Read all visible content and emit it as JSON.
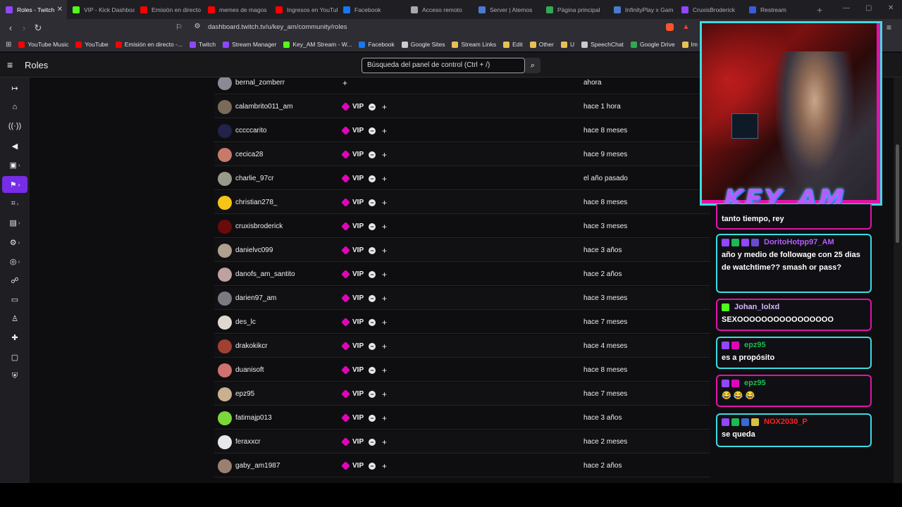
{
  "browser": {
    "tabs": [
      {
        "label": "Roles - Twitch",
        "color": "#9146ff"
      },
      {
        "label": "VIP - Kick Dashboard",
        "color": "#53fc18"
      },
      {
        "label": "Emisión en directo",
        "color": "#ff0000"
      },
      {
        "label": "memes de magos",
        "color": "#ff0000"
      },
      {
        "label": "Ingresos en YouTube",
        "color": "#ff0000"
      },
      {
        "label": "Facebook",
        "color": "#1877f2"
      },
      {
        "label": "Acceso remoto",
        "color": "#aaaaaa"
      },
      {
        "label": "Server | Atemos",
        "color": "#4a7bd0"
      },
      {
        "label": "Página principal",
        "color": "#34a853"
      },
      {
        "label": "InfinityPlay x Gam",
        "color": "#4a7bd0"
      },
      {
        "label": "CruxisBroderick",
        "color": "#9146ff"
      },
      {
        "label": "Restream",
        "color": "#3b5bdb"
      }
    ],
    "url": "dashboard.twitch.tv/u/key_am/community/roles",
    "bookmarks": [
      {
        "label": "YouTube Music",
        "color": "#ff0000"
      },
      {
        "label": "YouTube",
        "color": "#ff0000"
      },
      {
        "label": "Emisión en directo -...",
        "color": "#ff0000"
      },
      {
        "label": "Twitch",
        "color": "#9146ff"
      },
      {
        "label": "Stream Manager",
        "color": "#9146ff"
      },
      {
        "label": "Key_AM Stream - W...",
        "color": "#53fc18"
      },
      {
        "label": "Facebook",
        "color": "#1877f2"
      },
      {
        "label": "Google Sites",
        "color": "#cccccc"
      },
      {
        "label": "Stream Links",
        "color": "#e8c056"
      },
      {
        "label": "Edit",
        "color": "#e8c056"
      },
      {
        "label": "Other",
        "color": "#e8c056"
      },
      {
        "label": "U",
        "color": "#e8c056"
      },
      {
        "label": "SpeechChat",
        "color": "#cccccc"
      },
      {
        "label": "Google Drive",
        "color": "#34a853"
      },
      {
        "label": "Im",
        "color": "#e8c056"
      }
    ]
  },
  "header": {
    "title": "Roles",
    "search_placeholder": "Búsqueda del panel de control (Ctrl + /)"
  },
  "roles_table": {
    "rows": [
      {
        "user": "bernal_zomberr",
        "vip": false,
        "date": "ahora",
        "avatar": "#8a8a96"
      },
      {
        "user": "calambrito011_am",
        "vip": true,
        "date": "hace 1 hora",
        "avatar": "#7a6a5a"
      },
      {
        "user": "cccccarito",
        "vip": true,
        "date": "hace 8 meses",
        "avatar": "#22224a"
      },
      {
        "user": "cecica28",
        "vip": true,
        "date": "hace 9 meses",
        "avatar": "#c87a6a"
      },
      {
        "user": "charlie_97cr",
        "vip": true,
        "date": "el año pasado",
        "avatar": "#9a9a8a"
      },
      {
        "user": "christian278_",
        "vip": true,
        "date": "hace 8 meses",
        "avatar": "#f5c518"
      },
      {
        "user": "cruxisbroderick",
        "vip": true,
        "date": "hace 3 meses",
        "avatar": "#6a0a0a"
      },
      {
        "user": "danielvc099",
        "vip": true,
        "date": "hace 3 años",
        "avatar": "#b0a090"
      },
      {
        "user": "danofs_am_santito",
        "vip": true,
        "date": "hace 2 años",
        "avatar": "#c0a0a0"
      },
      {
        "user": "darien97_am",
        "vip": true,
        "date": "hace 3 meses",
        "avatar": "#7a7a80"
      },
      {
        "user": "des_lc",
        "vip": true,
        "date": "hace 7 meses",
        "avatar": "#e0d8d0"
      },
      {
        "user": "drakokikcr",
        "vip": true,
        "date": "hace 4 meses",
        "avatar": "#a04030"
      },
      {
        "user": "duanisoft",
        "vip": true,
        "date": "hace 8 meses",
        "avatar": "#d07070"
      },
      {
        "user": "epz95",
        "vip": true,
        "date": "hace 7 meses",
        "avatar": "#c8b090"
      },
      {
        "user": "fatimajp013",
        "vip": true,
        "date": "hace 3 años",
        "avatar": "#7ad83a"
      },
      {
        "user": "feraxxcr",
        "vip": true,
        "date": "hace 2 meses",
        "avatar": "#e8e8e8"
      },
      {
        "user": "gaby_am1987",
        "vip": true,
        "date": "hace 2 años",
        "avatar": "#9a8070"
      }
    ],
    "vip_label": "VIP"
  },
  "overlay": {
    "logo_text": "KEY_AM",
    "chat": [
      {
        "user": "",
        "user_color": "#ffffff",
        "message": "tanto tiempo, rey",
        "border": "pink",
        "badges": []
      },
      {
        "user": "DoritoHotpp97_AM",
        "user_color": "#b45cff",
        "message": "año y medio de followage con 25 dias de watchtime?? smash or pass?",
        "border": "cyan",
        "badges": [
          "#9146ff",
          "#1db954",
          "#9146ff",
          "#6a4ad0"
        ]
      },
      {
        "user": "Johan_lolxd",
        "user_color": "#d8b6ff",
        "message": "SEXOOOOOOOOOOOOOOOO",
        "border": "pink",
        "badges": [
          "#53fc18"
        ]
      },
      {
        "user": "epz95",
        "user_color": "#1db954",
        "message": "es a propósito",
        "border": "cyan",
        "badges": [
          "#9146ff",
          "#e005b9"
        ]
      },
      {
        "user": "epz95",
        "user_color": "#1db954",
        "message": "😂 😂 😂",
        "border": "pink",
        "badges": [
          "#9146ff",
          "#e005b9"
        ]
      },
      {
        "user": "NOX2030_P",
        "user_color": "#ff2020",
        "message": "se queda",
        "border": "cyan",
        "badges": [
          "#9146ff",
          "#1db954",
          "#3a6ad0",
          "#d8c040"
        ]
      }
    ]
  }
}
